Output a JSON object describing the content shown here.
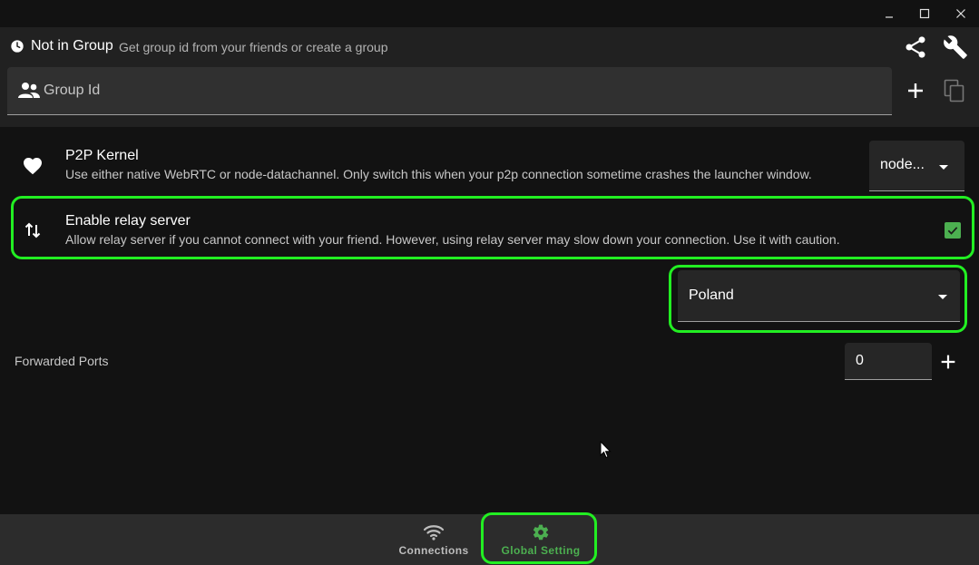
{
  "header": {
    "status_title": "Not in Group",
    "status_hint": "Get group id from your friends or create a group",
    "group_field": {
      "placeholder": "Group Id",
      "value": ""
    }
  },
  "settings": {
    "p2p_kernel": {
      "title": "P2P Kernel",
      "description": "Use either native WebRTC or node-datachannel. Only switch this when your p2p connection sometime crashes the launcher window.",
      "selected": "node..."
    },
    "relay": {
      "title": "Enable relay server",
      "description": "Allow relay server if you cannot connect with your friend. However, using relay server may slow down your connection. Use it with caution.",
      "checked": true
    },
    "relay_region": {
      "selected": "Poland"
    },
    "forwarded_ports": {
      "label": "Forwarded Ports",
      "value": "0"
    }
  },
  "nav": {
    "connections": "Connections",
    "global_setting": "Global Setting"
  },
  "colors": {
    "accent": "#4caf50",
    "highlight": "#22ee22",
    "header_bg": "#212121",
    "body_bg": "#121212",
    "nav_bg": "#2c2c2c"
  },
  "icons": {
    "status": "clock-icon",
    "share": "share-icon",
    "settings": "wrench-icon",
    "group": "people-icon",
    "add": "plus-icon",
    "copy": "copy-icon",
    "kernel": "heart-icon",
    "relay": "swap-vertical-icon",
    "connections": "wifi-icon",
    "global": "gear-icon"
  }
}
